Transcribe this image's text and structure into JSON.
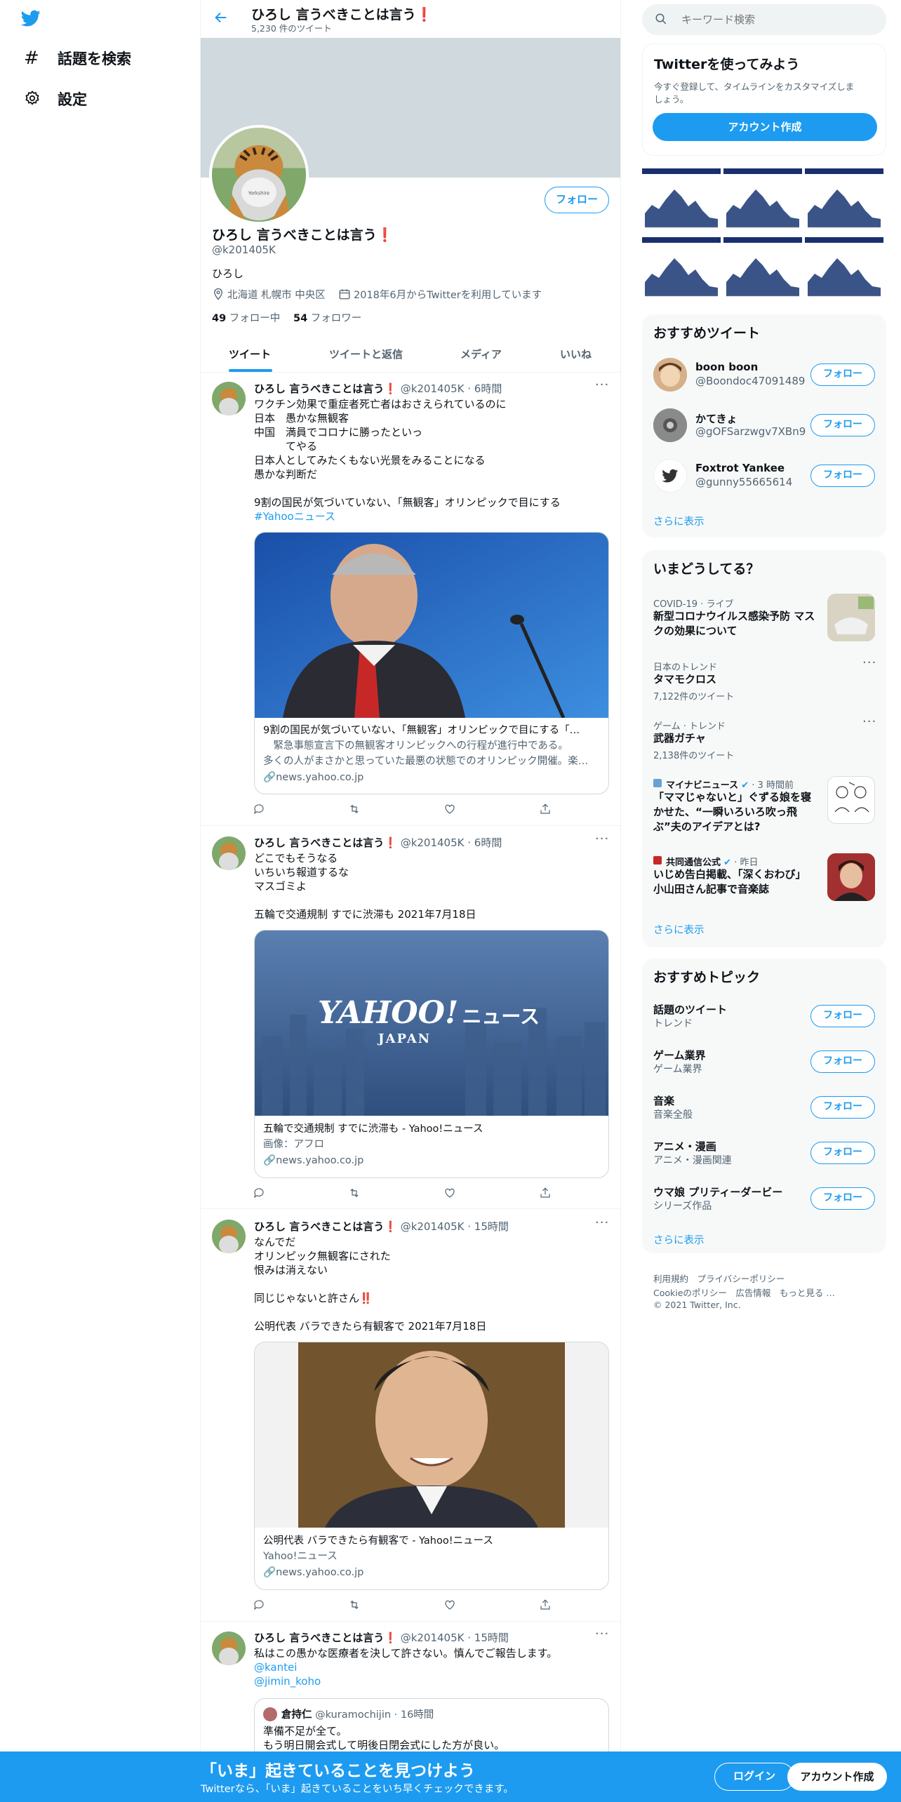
{
  "colors": {
    "accent": "#1d9bf0",
    "bottom_bar": "#1d9bf0",
    "banner": "#cfd9de"
  },
  "left_nav": {
    "items": [
      {
        "label": "話題を検索",
        "icon": "hash-icon"
      },
      {
        "label": "設定",
        "icon": "gear-icon"
      }
    ]
  },
  "header": {
    "title": "ひろし 言うべきことは言う❗",
    "tweet_count": "5,230 件のツイート"
  },
  "profile": {
    "name": "ひろし 言うべきことは言う❗",
    "handle": "@k201405K",
    "bio": "ひろし",
    "location": "北海道 札幌市 中央区",
    "joined": "2018年6月からTwitterを利用しています",
    "following_count": "49",
    "following_label": " フォロー中",
    "followers_count": "54",
    "followers_label": " フォロワー",
    "follow_label": "フォロー"
  },
  "tabs": [
    "ツイート",
    "ツイートと返信",
    "メディア",
    "いいね"
  ],
  "tweets": [
    {
      "name": "ひろし 言うべきことは言う❗",
      "handle": "@k201405K",
      "time": "· 6時間",
      "lines": [
        "ワクチン効果で重症者死亡者はおさえられているのに",
        "日本　愚かな無観客",
        "中国　満員でコロナに勝ったといっ",
        "　　　てやる",
        "日本人としてみたくもない光景をみることになる",
        "愚かな判断だ",
        "",
        "9割の国民が気づいていない、「無観客」オリンピックで目にする"
      ],
      "hashtag": "#Yahooニュース",
      "card": {
        "title": "9割の国民が気づいていない、「無観客」オリンピックで目にする「…",
        "desc1": "　緊急事態宣言下の無観客オリンピックへの行程が進行中である。",
        "desc2": "多くの人がまさかと思っていた最悪の状態でのオリンピック開催。楽…",
        "domain": "news.yahoo.co.jp"
      }
    },
    {
      "name": "ひろし 言うべきことは言う❗",
      "handle": "@k201405K",
      "time": "· 6時間",
      "lines": [
        "どこでもそうなる",
        "いちいち報道するな",
        "マスゴミよ",
        "",
        "五輪で交通規制 すでに渋滞も 2021年7月18日"
      ],
      "card": {
        "logo": "YAHOO!",
        "logo_sub": "JAPAN",
        "logo_news": "ニュース",
        "title": "五輪で交通規制 すでに渋滞も - Yahoo!ニュース",
        "desc1": "画像：アフロ",
        "domain": "news.yahoo.co.jp"
      }
    },
    {
      "name": "ひろし 言うべきことは言う❗",
      "handle": "@k201405K",
      "time": "· 15時間",
      "lines": [
        "なんでだ",
        "オリンピック無観客にされた",
        "恨みは消えない",
        "",
        "同じじゃないと許さん‼️",
        "",
        "公明代表 バラできたら有観客で 2021年7月18日"
      ],
      "card": {
        "title": "公明代表 バラできたら有観客で - Yahoo!ニュース",
        "desc1": "Yahoo!ニュース",
        "domain": "news.yahoo.co.jp"
      }
    },
    {
      "name": "ひろし 言うべきことは言う❗",
      "handle": "@k201405K",
      "time": "· 15時間",
      "lines": [
        "私はこの愚かな医療者を決して許さない。慎んでご報告します。"
      ],
      "mentions": [
        "@kantei",
        "@jimin_koho"
      ],
      "quote": {
        "name": "倉持仁",
        "handle": "@kuramochijin",
        "time": "· 16時間",
        "lines": [
          "準備不足が全て。",
          "もう明日開会式して明後日閉会式にした方が良い。"
        ]
      }
    }
  ],
  "search": {
    "placeholder": "キーワード検索"
  },
  "signup": {
    "title": "Twitterを使ってみよう",
    "desc1": "今すぐ登録して、タイムラインをカスタマイズしま",
    "desc2": "しょう。",
    "button": "アカウント作成"
  },
  "recommended_tweets": {
    "title": "おすすめツイート",
    "users": [
      {
        "name": "boon boon",
        "handle": "@Boondoc47091489"
      },
      {
        "name": "かてきょ",
        "handle": "@gOFSarzwgv7XBn9"
      },
      {
        "name": "Foxtrot Yankee",
        "handle": "@gunny55665614"
      }
    ],
    "follow_label": "フォロー",
    "more": "さらに表示"
  },
  "trends": {
    "title": "いまどうしてる？",
    "items": [
      {
        "meta": "COVID-19 · ライブ",
        "title": "新型コロナウイルス感染予防 マス\nクの効果について"
      },
      {
        "meta": "日本のトレンド",
        "title": "タマモクロス",
        "count": "7,122件のツイート"
      },
      {
        "meta": "ゲーム · トレンド",
        "title": "武器ガチャ",
        "count": "2,138件のツイート"
      },
      {
        "meta": "マイナビニュース",
        "meta2": "· 3 時間前",
        "title": "「ママじゃないと」ぐずる娘を寝\nかせた、“一瞬いろいろ吹っ飛\nぶ”夫のアイデアとは?"
      },
      {
        "meta": "共同通信公式",
        "meta2": "· 昨日",
        "title": "いじめ告白掲載、「深くおわび」\n小山田さん記事で音楽誌"
      }
    ],
    "more": "さらに表示"
  },
  "topics": {
    "title": "おすすめトピック",
    "items": [
      {
        "title": "話題のツイート",
        "sub": "トレンド"
      },
      {
        "title": "ゲーム業界",
        "sub": "ゲーム業界"
      },
      {
        "title": "音楽",
        "sub": "音楽全般"
      },
      {
        "title": "アニメ・漫画",
        "sub": "アニメ・漫画関連"
      },
      {
        "title": "ウマ娘 プリティーダービー",
        "sub": "シリーズ作品"
      }
    ],
    "follow_label": "フォロー",
    "more": "さらに表示"
  },
  "footer": {
    "line1": "利用規約　プライバシーポリシー",
    "line2": "Cookieのポリシー　広告情報　もっと見る …",
    "line3": "© 2021 Twitter, Inc."
  },
  "bottom_bar": {
    "title": "「いま」起きていることを見つけよう",
    "sub": "Twitterなら、「いま」起きていることをいち早くチェックできます。",
    "login": "ログイン",
    "signup": "アカウント作成"
  }
}
